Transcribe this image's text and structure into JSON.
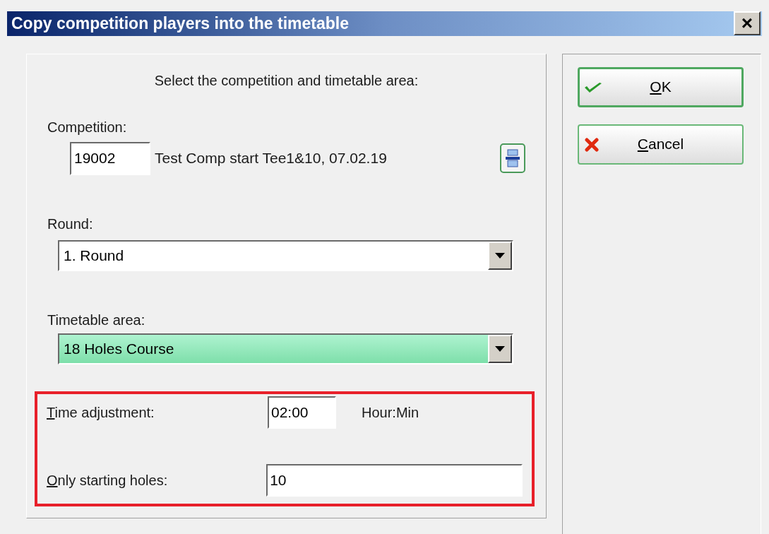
{
  "window": {
    "title": "Copy competition players into the timetable",
    "close": "×"
  },
  "heading": "Select the competition and timetable area:",
  "competition": {
    "label": "Competition:",
    "value": "19002",
    "description": "Test Comp start Tee1&10, 07.02.19"
  },
  "round": {
    "label": "Round:",
    "value": "1. Round",
    "highlighted": false
  },
  "timetable_area": {
    "label": "Timetable area:",
    "value": "18 Holes Course",
    "highlighted": true
  },
  "highlight_box": true,
  "time_adjustment": {
    "label": "Time adjustment:",
    "mnemonic_first": true,
    "value": "02:00",
    "unit": "Hour:Min"
  },
  "starting_holes": {
    "label": "Only starting holes:",
    "mnemonic_first": true,
    "value": "10"
  },
  "buttons": [
    {
      "label": "OK",
      "kind": "ok",
      "mnemonic_first": true,
      "focused": true
    },
    {
      "label": "Cancel",
      "kind": "cancel",
      "mnemonic_first": true,
      "focused": false
    }
  ]
}
